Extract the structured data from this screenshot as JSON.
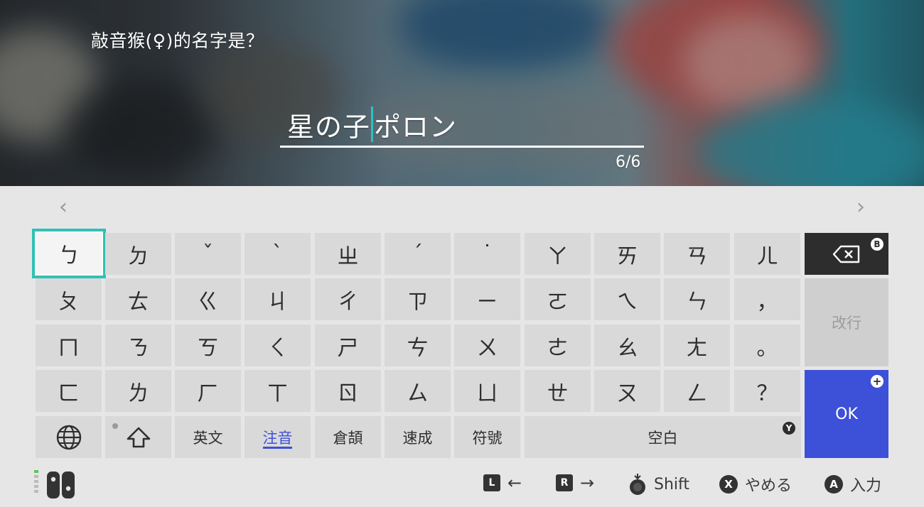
{
  "prompt": {
    "text": "敲音猴(♀)的名字是？"
  },
  "name_input": {
    "before_caret": "星の子",
    "after_caret": "ポロン",
    "counter": "6/6"
  },
  "nav": {
    "prev": "‹",
    "next": "›"
  },
  "rows": [
    [
      "ㄅ",
      "ㄉ",
      "ˇ",
      "ˋ",
      "ㄓ",
      "ˊ",
      "˙",
      "ㄚ",
      "ㄞ",
      "ㄢ",
      "ㄦ"
    ],
    [
      "ㄆ",
      "ㄊ",
      "ㄍ",
      "ㄐ",
      "ㄔ",
      "ㄗ",
      "ㄧ",
      "ㄛ",
      "ㄟ",
      "ㄣ",
      "，"
    ],
    [
      "ㄇ",
      "ㄋ",
      "ㄎ",
      "ㄑ",
      "ㄕ",
      "ㄘ",
      "ㄨ",
      "ㄜ",
      "ㄠ",
      "ㄤ",
      "。"
    ],
    [
      "ㄈ",
      "ㄌ",
      "ㄏ",
      "ㄒ",
      "ㄖ",
      "ㄙ",
      "ㄩ",
      "ㄝ",
      "ㄡ",
      "ㄥ",
      "？"
    ]
  ],
  "bottom_row": {
    "globe_icon": "globe-icon",
    "shift_icon": "shift-arrow-icon",
    "modes": [
      "英文",
      "注音",
      "倉頡",
      "速成",
      "符號"
    ],
    "active_mode": "注音",
    "space_label": "空白",
    "space_badge": "Y"
  },
  "side_keys": {
    "backspace_badge": "B",
    "enter_label": "改行",
    "ok_label": "OK",
    "ok_badge": "+"
  },
  "footer": {
    "l_button": "L",
    "l_arrow": "←",
    "r_button": "R",
    "r_arrow": "→",
    "shift_label": "Shift",
    "x_button": "X",
    "x_label": "やめる",
    "a_button": "A",
    "a_label": "入力"
  },
  "colors": {
    "accent_blue": "#3d50d8",
    "selection_teal": "#2fc2b4",
    "key_bg": "#d9d9d9",
    "panel_bg": "#e6e6e6"
  }
}
